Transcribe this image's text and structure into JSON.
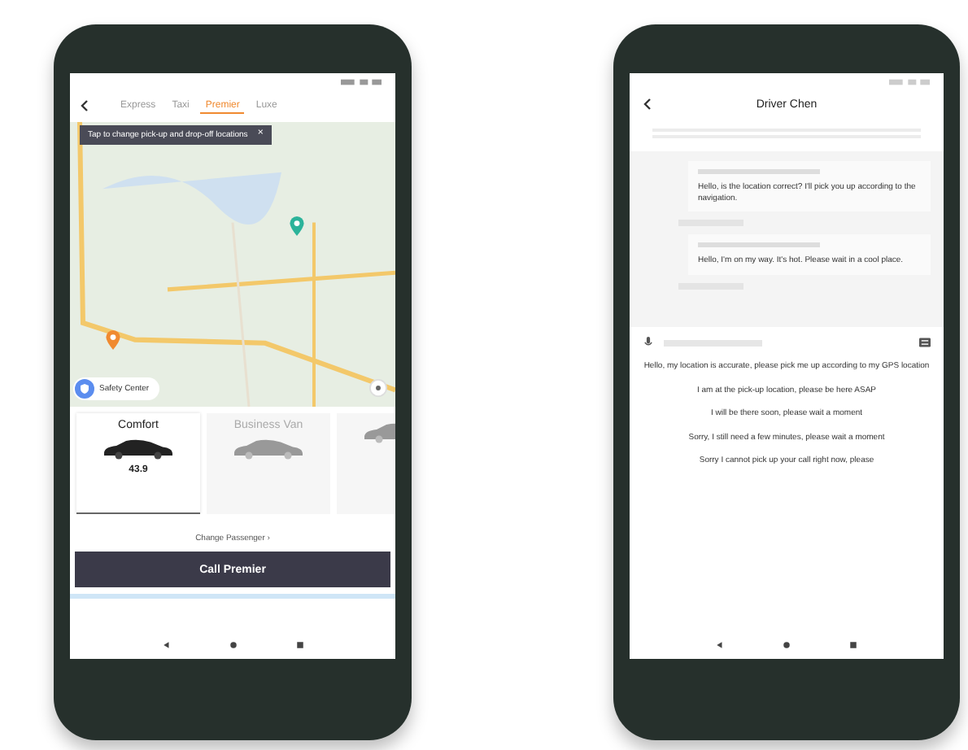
{
  "ride_screen": {
    "tabs": [
      {
        "label": "Express",
        "selected": false
      },
      {
        "label": "Taxi",
        "selected": false
      },
      {
        "label": "Premier",
        "selected": true
      },
      {
        "label": "Luxe",
        "selected": false
      }
    ],
    "tooltip": "Tap to change pick-up and drop-off locations",
    "tooltip_close": "×",
    "safety_center": "Safety Center",
    "car_options": [
      {
        "name": "Comfort",
        "price": "43.9",
        "selected": true
      },
      {
        "name": "Business Van",
        "selected": false
      },
      {
        "selected": false
      }
    ],
    "change_passenger": "Change Passenger ›",
    "call_button": "Call Premier"
  },
  "chat_screen": {
    "title": "Driver Chen",
    "messages": [
      "Hello, is the location correct? I'll pick you up according to the navigation.",
      "Hello, I'm on my way. It's hot. Please wait in a cool place."
    ],
    "quick_replies": [
      "Hello, my location is accurate, please pick me up according to my GPS location",
      "I am at the pick-up location, please be here ASAP",
      "I will be there soon, please wait a moment",
      "Sorry, I still need a few minutes, please wait a moment",
      "Sorry I cannot pick up your call right now, please"
    ]
  }
}
